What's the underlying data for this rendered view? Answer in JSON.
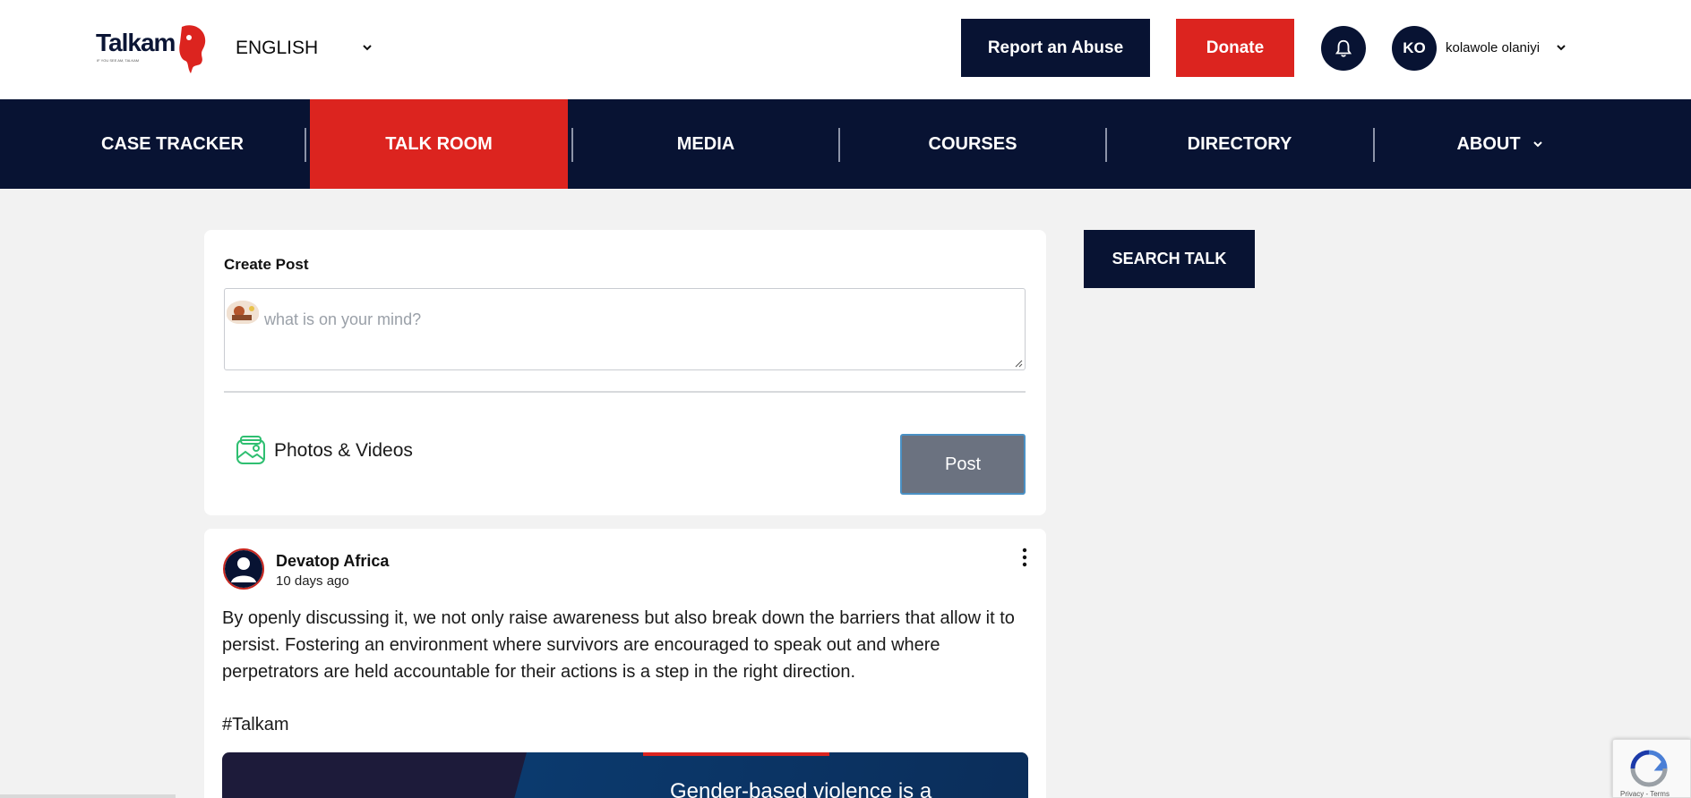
{
  "header": {
    "logo_text": "Talkam",
    "logo_subtext": "IF YOU SEE AM, TALKAM",
    "language": "ENGLISH",
    "report_label": "Report an Abuse",
    "donate_label": "Donate",
    "user_initials": "KO",
    "user_name": "kolawole olaniyi"
  },
  "nav": {
    "items": [
      {
        "label": "CASE TRACKER"
      },
      {
        "label": "TALK ROOM",
        "active": true
      },
      {
        "label": "MEDIA"
      },
      {
        "label": "COURSES"
      },
      {
        "label": "DIRECTORY"
      },
      {
        "label": "ABOUT"
      }
    ]
  },
  "create_post": {
    "title": "Create Post",
    "placeholder": "what is on your mind?",
    "photos_label": "Photos & Videos",
    "post_label": "Post"
  },
  "post": {
    "author": "Devatop Africa",
    "time": "10 days ago",
    "body": "By openly discussing it, we not only raise awareness but also break down the barriers that allow it to persist. Fostering an environment where survivors are encouraged to speak out and where perpetrators are held accountable for their actions is a step in the right direction.",
    "tag": "#Talkam",
    "image_caption": "Gender-based violence is a"
  },
  "sidebar": {
    "search_label": "SEARCH TALK"
  },
  "recaptcha": {
    "links": "Privacy - Terms"
  },
  "colors": {
    "navy": "#081333",
    "red": "#dc241f",
    "post_button": "#6b7280",
    "background": "#f2f2f2"
  },
  "icons": [
    "chevron-down-icon",
    "bell-icon",
    "photo-icon",
    "more-vertical-icon",
    "user-icon",
    "recaptcha-icon"
  ]
}
